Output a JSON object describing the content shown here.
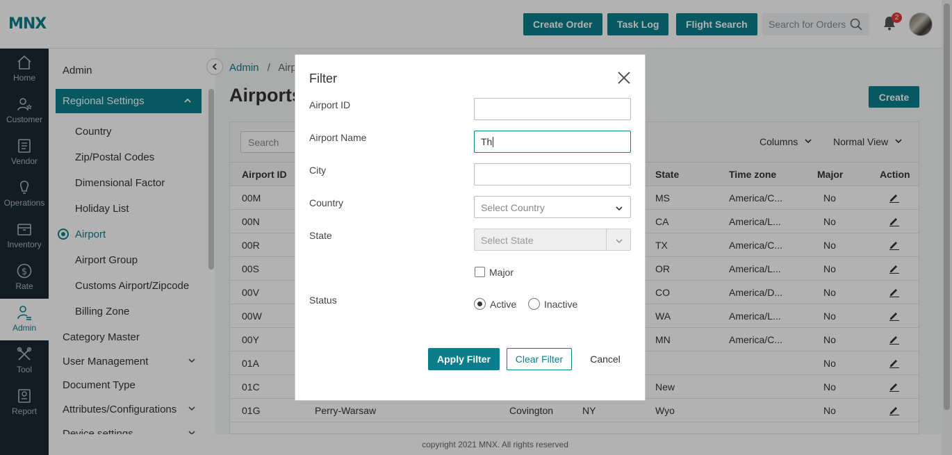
{
  "header": {
    "logo": "MNX",
    "buttons": [
      "Create Order",
      "Task Log",
      "Flight Search"
    ],
    "search_placeholder": "Search for Orders",
    "notification_count": "2"
  },
  "rail": {
    "items": [
      "Home",
      "Customer",
      "Vendor",
      "Operations",
      "Inventory",
      "Rate",
      "Admin",
      "Tool",
      "Report"
    ],
    "active": "Admin"
  },
  "subnav": {
    "title": "Admin",
    "group": "Regional Settings",
    "group_items": [
      "Country",
      "Zip/Postal Codes",
      "Dimensional Factor",
      "Holiday List",
      "Airport",
      "Airport Group",
      "Customs Airport/Zipcode",
      "Billing Zone"
    ],
    "active_item": "Airport",
    "top_items": [
      "Category Master",
      "User Management",
      "Document Type",
      "Attributes/Configurations",
      "Device settings"
    ]
  },
  "breadcrumb": {
    "root": "Admin",
    "separator": "/",
    "current": "Airpo"
  },
  "page": {
    "title": "Airports",
    "create_label": "Create"
  },
  "toolbar": {
    "search_placeholder": "Search",
    "columns_label": "Columns",
    "view_label": "Normal View"
  },
  "table": {
    "headers": [
      "Airport ID",
      "State",
      "Time zone",
      "Major",
      "Action"
    ],
    "rows": [
      {
        "id": "00M",
        "name": "",
        "city": "",
        "country": "",
        "state": "MS",
        "tz": "America/C...",
        "major": "No"
      },
      {
        "id": "00N",
        "name": "",
        "city": "",
        "country": "",
        "state": "CA",
        "tz": "America/L...",
        "major": "No"
      },
      {
        "id": "00R",
        "name": "",
        "city": "",
        "country": "",
        "state": "TX",
        "tz": "America/C...",
        "major": "No"
      },
      {
        "id": "00S",
        "name": "",
        "city": "",
        "country": "",
        "state": "OR",
        "tz": "America/L...",
        "major": "No"
      },
      {
        "id": "00V",
        "name": "",
        "city": "",
        "country": "",
        "state": "CO",
        "tz": "America/D...",
        "major": "No"
      },
      {
        "id": "00W",
        "name": "",
        "city": "",
        "country": "",
        "state": "WA",
        "tz": "America/L...",
        "major": "No"
      },
      {
        "id": "00Y",
        "name": "",
        "city": "",
        "country": "",
        "state": "MN",
        "tz": "America/C...",
        "major": "No"
      },
      {
        "id": "01A",
        "name": "",
        "city": "",
        "country": "",
        "state": "",
        "tz": "",
        "major": "No"
      },
      {
        "id": "01C",
        "name": "",
        "city": "",
        "country": "",
        "state": "New",
        "tz": "",
        "major": "No"
      },
      {
        "id": "01G",
        "name": "Perry-Warsaw",
        "city": "Covington",
        "country": "NY",
        "state": "Wyo",
        "tz": "",
        "major": "No"
      }
    ]
  },
  "footer": "copyright 2021 MNX. All rights reserved",
  "modal": {
    "title": "Filter",
    "fields": {
      "airport_id_label": "Airport ID",
      "airport_id_value": "",
      "airport_name_label": "Airport Name",
      "airport_name_value": "Th",
      "city_label": "City",
      "city_value": "",
      "country_label": "Country",
      "country_placeholder": "Select Country",
      "state_label": "State",
      "state_placeholder": "Select State",
      "major_label": "Major",
      "status_label": "Status",
      "status_options": [
        "Active",
        "Inactive"
      ],
      "status_selected": "Active"
    },
    "apply_label": "Apply Filter",
    "clear_label": "Clear Filter",
    "cancel_label": "Cancel"
  },
  "colors": {
    "brand": "#0a7e8c",
    "rail": "#1c2736",
    "badge": "#e53935"
  }
}
